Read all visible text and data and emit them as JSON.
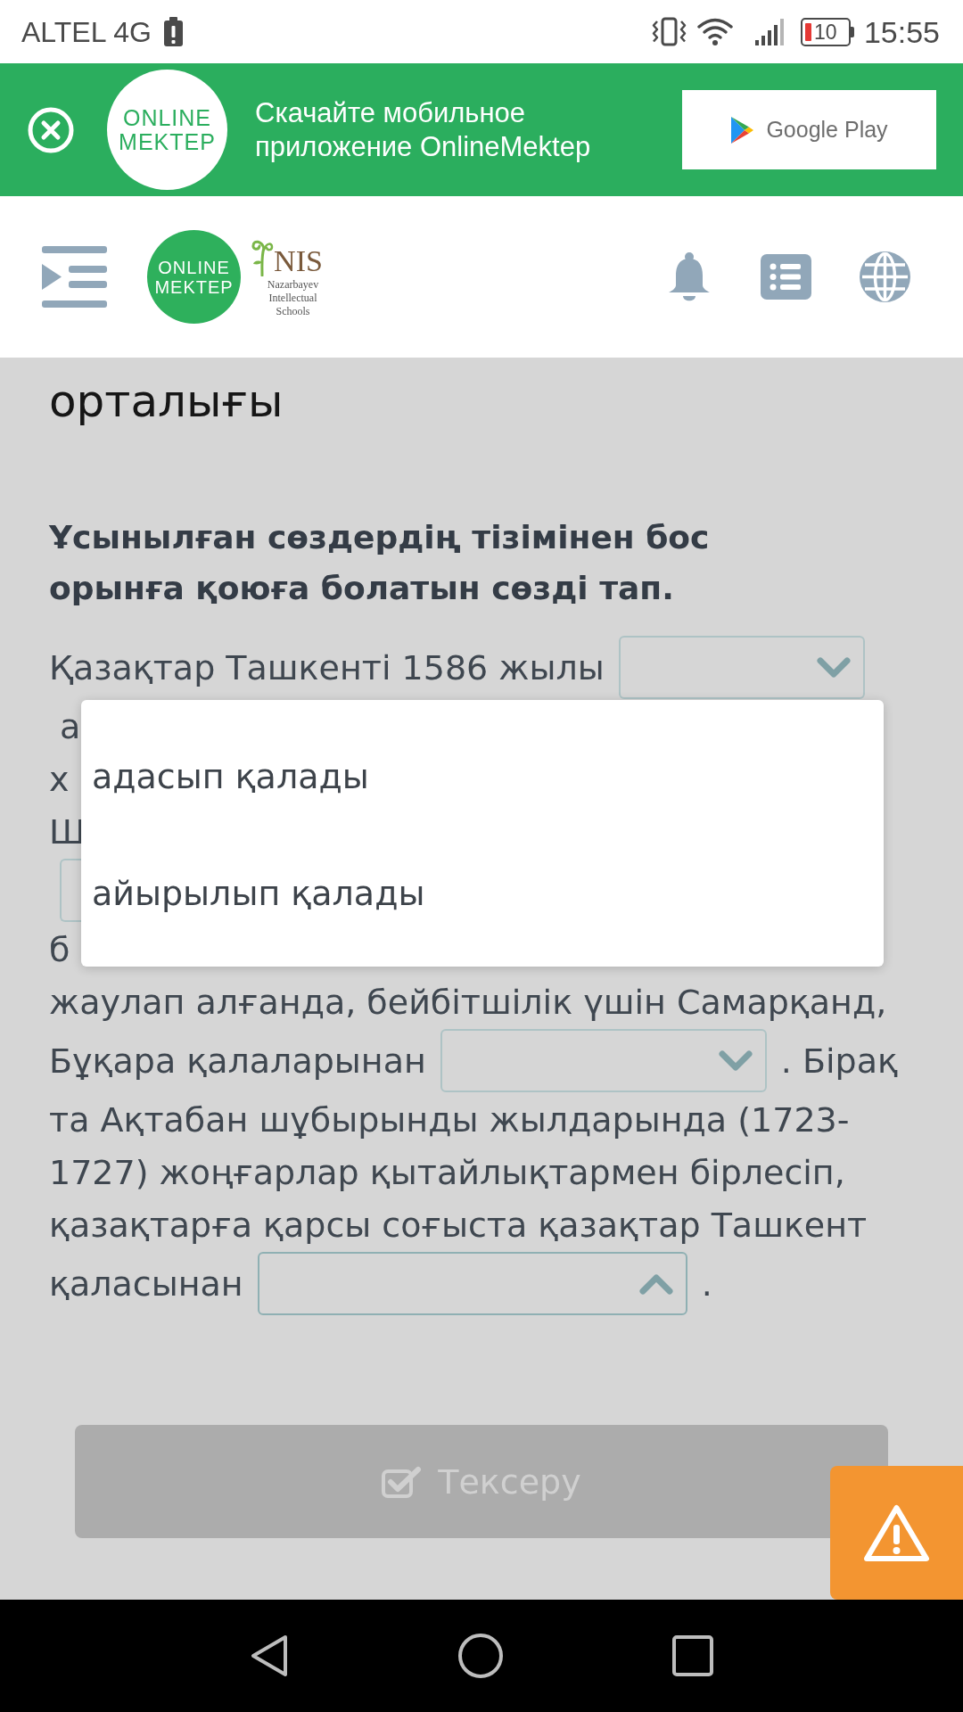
{
  "status_bar": {
    "carrier": "ALTEL 4G",
    "battery_level": "10",
    "time": "15:55"
  },
  "app_banner": {
    "logo": "ONLINE MEKTEP",
    "text": "Скачайте мобильное приложение OnlineMektep",
    "store_button": "Google Play"
  },
  "header": {
    "logo": "ONLINE MEKTEP",
    "partner_logo": {
      "name": "NIS",
      "caption": "Nazarbayev Intellectual Schools"
    }
  },
  "lesson": {
    "title": "орталығы",
    "instruction": "Ұсынылған сөздердің тізімінен бос орынға қоюға болатын сөзді тап.",
    "text_lines": [
      {
        "segments": [
          {
            "kind": "text",
            "text": "Қазақтар Ташкенті 1586 жылы"
          },
          {
            "kind": "dropdown",
            "expanded": false
          }
        ]
      },
      {
        "segments": [
          {
            "kind": "text",
            "text": " а"
          }
        ]
      },
      {
        "segments": [
          {
            "kind": "text",
            "text": "х"
          }
        ]
      },
      {
        "segments": [
          {
            "kind": "text",
            "text": "Ш"
          }
        ]
      },
      {
        "segments": [
          {
            "kind": "dropdown_edge"
          }
        ]
      },
      {
        "segments": [
          {
            "kind": "text",
            "text": "б"
          }
        ]
      },
      {
        "segments": [
          {
            "kind": "text",
            "text": "жаулап алғанда, бейбітшілік үшін Самарқанд,"
          }
        ]
      },
      {
        "segments": [
          {
            "kind": "text",
            "text": "Бұқара қалаларынан"
          },
          {
            "kind": "dropdown",
            "expanded": false
          },
          {
            "kind": "text",
            "text": ". Бірақ"
          }
        ]
      },
      {
        "segments": [
          {
            "kind": "text",
            "text": "та Ақтабан шұбырынды жылдарында (1723-"
          }
        ]
      },
      {
        "segments": [
          {
            "kind": "text",
            "text": "1727) жоңғарлар қытайлықтармен бірлесіп,"
          }
        ]
      },
      {
        "segments": [
          {
            "kind": "text",
            "text": "қазақтарға қарсы соғыста қазақтар Ташкент"
          }
        ]
      },
      {
        "segments": [
          {
            "kind": "text",
            "text": "қаласынан"
          },
          {
            "kind": "dropdown",
            "expanded": true
          },
          {
            "kind": "text",
            "text": "."
          }
        ]
      }
    ],
    "dropdown_menu": {
      "options": [
        {
          "label": "адасып қалады",
          "selected": false
        },
        {
          "label": "айырылып қалады",
          "selected": false
        }
      ]
    },
    "check_button": {
      "label": "Тексеру",
      "disabled": true
    }
  }
}
